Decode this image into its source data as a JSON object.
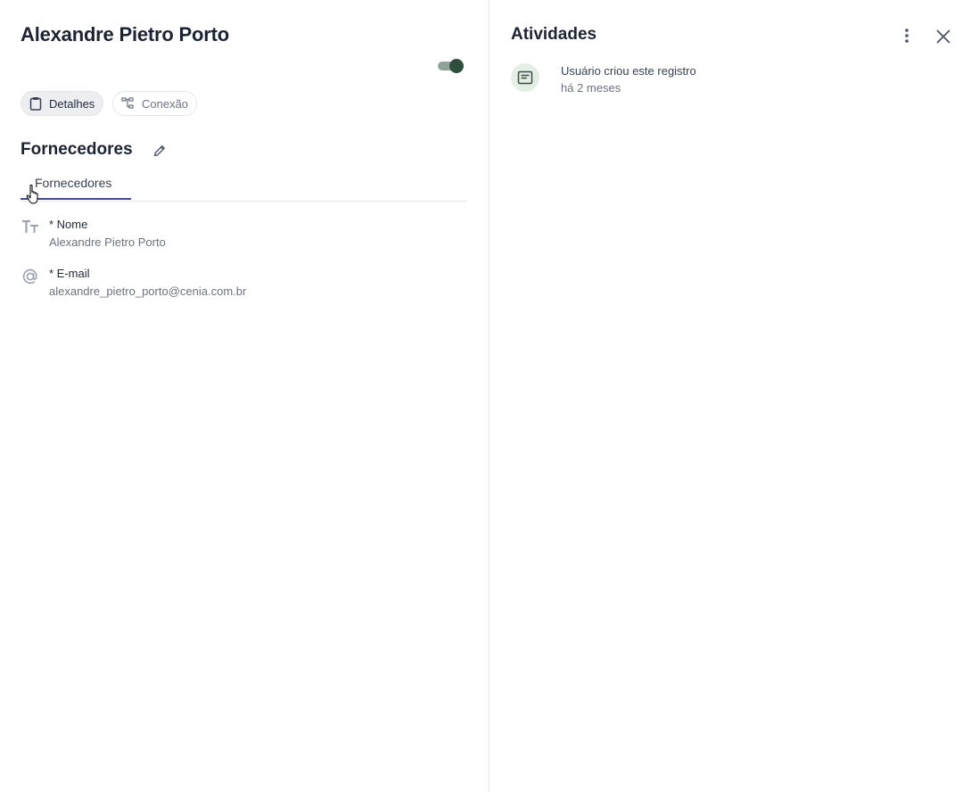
{
  "record": {
    "title": "Alexandre Pietro Porto",
    "toggle_on": true
  },
  "view_tabs": [
    {
      "label": "Detalhes",
      "icon": "clipboard-icon",
      "active": true
    },
    {
      "label": "Conexão",
      "icon": "hierarchy-icon",
      "active": false
    }
  ],
  "section": {
    "title": "Fornecedores",
    "tab_label": "Fornecedores"
  },
  "fields": {
    "nome": {
      "label": "* Nome",
      "value": "Alexandre Pietro Porto",
      "icon": "text-type-icon"
    },
    "email": {
      "label": "* E-mail",
      "value": "alexandre_pietro_porto@cenia.com.br",
      "icon": "at-sign-icon"
    }
  },
  "activities": {
    "title": "Atividades",
    "items": [
      {
        "text": "Usuário criou este registro",
        "time": "há 2 meses",
        "icon": "note-icon"
      }
    ]
  },
  "colors": {
    "accent": "#3f4a9e",
    "toggle": "#2f4f3e",
    "activity_avatar_bg": "#e3efe5"
  }
}
